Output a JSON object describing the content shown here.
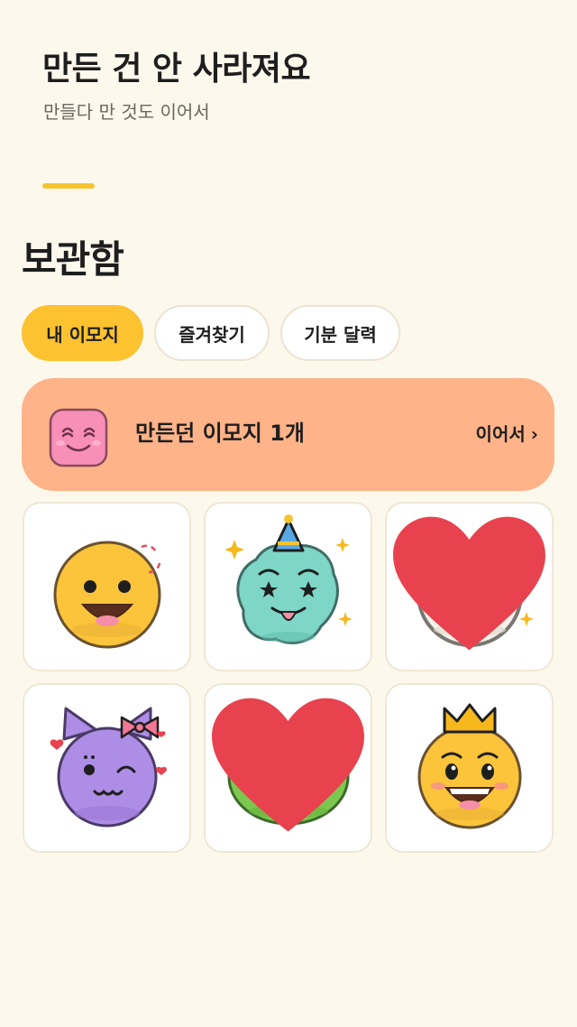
{
  "hero": {
    "title": "만든 건 안 사라져요",
    "subtitle": "만들다 만 것도 이어서"
  },
  "section": {
    "title": "보관함"
  },
  "tabs": [
    {
      "label": "내 이모지",
      "active": true
    },
    {
      "label": "즐겨찾기",
      "active": false
    },
    {
      "label": "기분 달력",
      "active": false
    }
  ],
  "draft": {
    "label": "만든던 이모지 1개",
    "action_label": "이어서",
    "chevron": "›",
    "icon": "pink-smile-emoji-icon"
  },
  "emojis": [
    {
      "name": "yellow-blush-smile-emoji",
      "favorite": false
    },
    {
      "name": "teal-party-star-eyes-emoji",
      "favorite": false
    },
    {
      "name": "white-surprised-emoji",
      "favorite": true
    },
    {
      "name": "purple-cat-wink-emoji",
      "favorite": false
    },
    {
      "name": "green-sunglasses-emoji",
      "favorite": true
    },
    {
      "name": "yellow-crown-emoji",
      "favorite": false
    }
  ],
  "colors": {
    "background": "#FDF8EC",
    "accent": "#FDC230",
    "draft_card": "#FFB388",
    "heart": "#E8424E"
  }
}
